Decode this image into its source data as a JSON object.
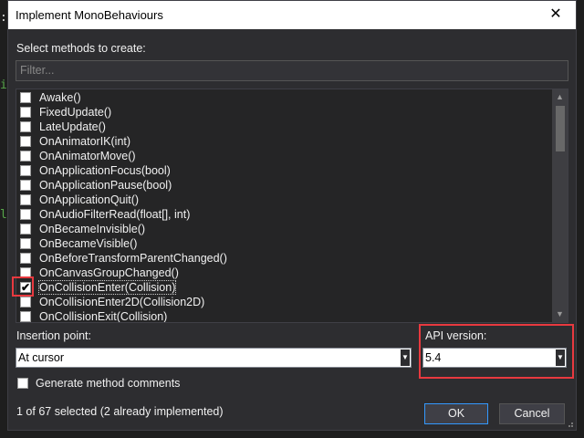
{
  "background_glyphs": [
    {
      "text": ":",
      "color": "#dcdcdc"
    },
    {
      "text": "i",
      "color": "#57a64a"
    },
    {
      "text": "l",
      "color": "#57a64a"
    }
  ],
  "dialog": {
    "title": "Implement MonoBehaviours",
    "close_glyph": "✕"
  },
  "methods": {
    "label": "Select methods to create:",
    "filter_placeholder": "Filter...",
    "items": [
      {
        "label": "Awake()",
        "checked": false
      },
      {
        "label": "FixedUpdate()",
        "checked": false
      },
      {
        "label": "LateUpdate()",
        "checked": false
      },
      {
        "label": "OnAnimatorIK(int)",
        "checked": false
      },
      {
        "label": "OnAnimatorMove()",
        "checked": false
      },
      {
        "label": "OnApplicationFocus(bool)",
        "checked": false
      },
      {
        "label": "OnApplicationPause(bool)",
        "checked": false
      },
      {
        "label": "OnApplicationQuit()",
        "checked": false
      },
      {
        "label": "OnAudioFilterRead(float[], int)",
        "checked": false
      },
      {
        "label": "OnBecameInvisible()",
        "checked": false
      },
      {
        "label": "OnBecameVisible()",
        "checked": false
      },
      {
        "label": "OnBeforeTransformParentChanged()",
        "checked": false
      },
      {
        "label": "OnCanvasGroupChanged()",
        "checked": false
      },
      {
        "label": "OnCollisionEnter(Collision)",
        "checked": true
      },
      {
        "label": "OnCollisionEnter2D(Collision2D)",
        "checked": false
      },
      {
        "label": "OnCollisionExit(Collision)",
        "checked": false
      }
    ],
    "check_glyph": "✔"
  },
  "insertion": {
    "label": "Insertion point:",
    "value": "At cursor"
  },
  "api": {
    "label": "API version:",
    "value": "5.4"
  },
  "generate_comments": {
    "label": "Generate method comments",
    "checked": false
  },
  "status": "1 of 67 selected (2 already implemented)",
  "buttons": {
    "ok": "OK",
    "cancel": "Cancel"
  },
  "colors": {
    "highlight_box": "#e8393f",
    "dialog_bg": "#2d2d30",
    "primary_border": "#3399ff"
  }
}
